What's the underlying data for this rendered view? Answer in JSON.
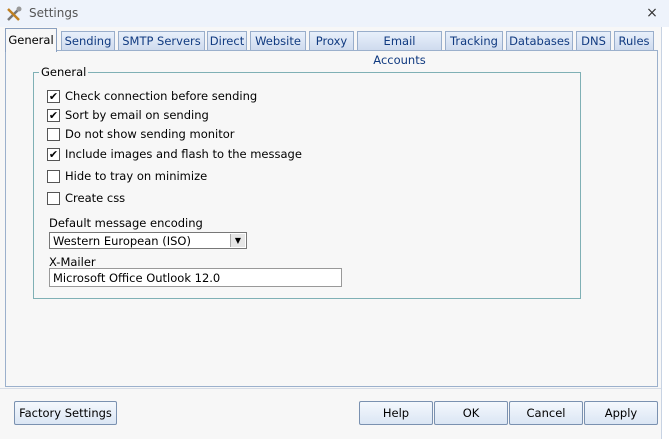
{
  "window": {
    "title": "Settings",
    "close_glyph": "×"
  },
  "tabs": [
    {
      "label": "General",
      "active": true
    },
    {
      "label": "Sending"
    },
    {
      "label": "SMTP Servers"
    },
    {
      "label": "Direct"
    },
    {
      "label": "Website"
    },
    {
      "label": "Proxy"
    },
    {
      "label": "Email Accounts"
    },
    {
      "label": "Tracking"
    },
    {
      "label": "Databases"
    },
    {
      "label": "DNS"
    },
    {
      "label": "Rules"
    }
  ],
  "general": {
    "group_title": "General",
    "options": [
      {
        "label": "Check connection before sending",
        "checked": true
      },
      {
        "label": "Sort by email on sending",
        "checked": true
      },
      {
        "label": "Do not show sending monitor",
        "checked": false
      },
      {
        "label": "Include images and flash to the message",
        "checked": true
      },
      {
        "label": "Hide to tray on minimize",
        "checked": false
      },
      {
        "label": "Create css",
        "checked": false
      }
    ],
    "encoding": {
      "label": "Default message encoding",
      "value": "Western European (ISO)"
    },
    "xmailer": {
      "label": "X-Mailer",
      "value": "Microsoft Office Outlook 12.0"
    }
  },
  "buttons": {
    "factory": "Factory Settings",
    "help": "Help",
    "ok": "OK",
    "cancel": "Cancel",
    "apply": "Apply"
  },
  "icons": {
    "app": "tools-icon",
    "close": "close-icon",
    "check": "✔",
    "dropdown": "▼"
  }
}
